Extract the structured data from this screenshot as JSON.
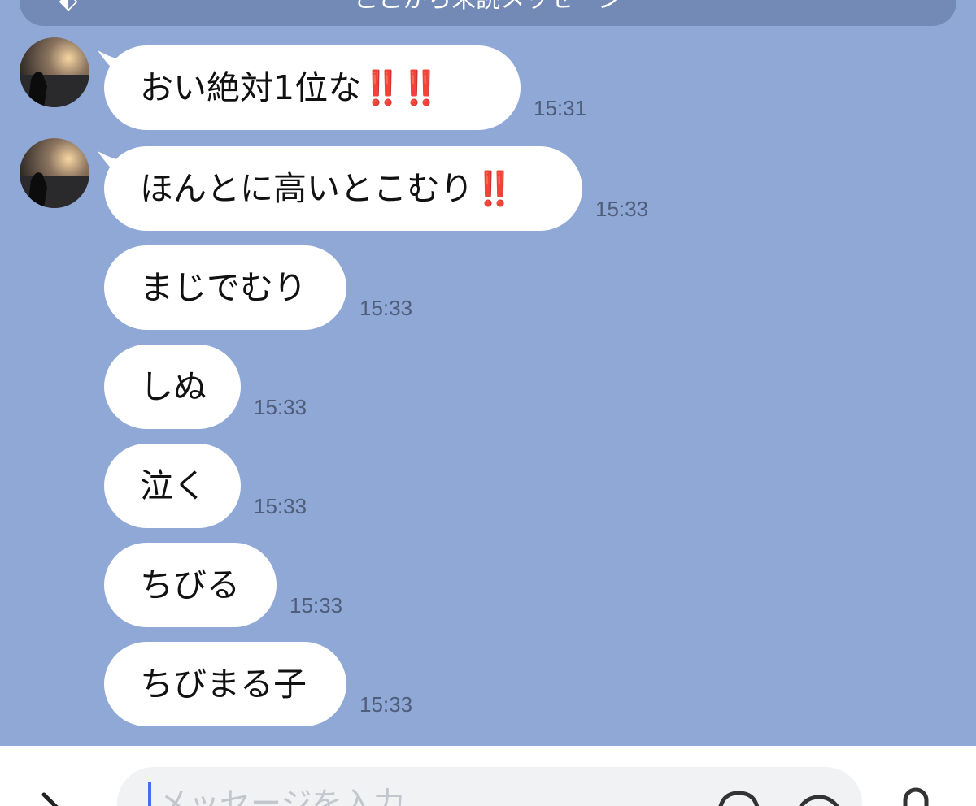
{
  "unread_bar": {
    "label": "ここから未読メッセージ",
    "icon": "tag-icon"
  },
  "messages": [
    {
      "text": "おい絶対1位な",
      "emoji": "‼️‼️",
      "time": "15:31",
      "avatar": true
    },
    {
      "text": "ほんとに高いとこむり",
      "emoji": "‼️",
      "time": "15:33",
      "avatar": true
    },
    {
      "text": "まじでむり",
      "emoji": "",
      "time": "15:33",
      "avatar": false
    },
    {
      "text": "しぬ",
      "emoji": "",
      "time": "15:33",
      "avatar": false
    },
    {
      "text": "泣く",
      "emoji": "",
      "time": "15:33",
      "avatar": false
    },
    {
      "text": "ちびる",
      "emoji": "",
      "time": "15:33",
      "avatar": false
    },
    {
      "text": "ちびまる子",
      "emoji": "",
      "time": "15:33",
      "avatar": false
    }
  ],
  "input": {
    "placeholder": "メッセージを入力"
  },
  "colors": {
    "background": "#8fa8d6",
    "bubble": "#ffffff",
    "accent": "#e2372b"
  }
}
